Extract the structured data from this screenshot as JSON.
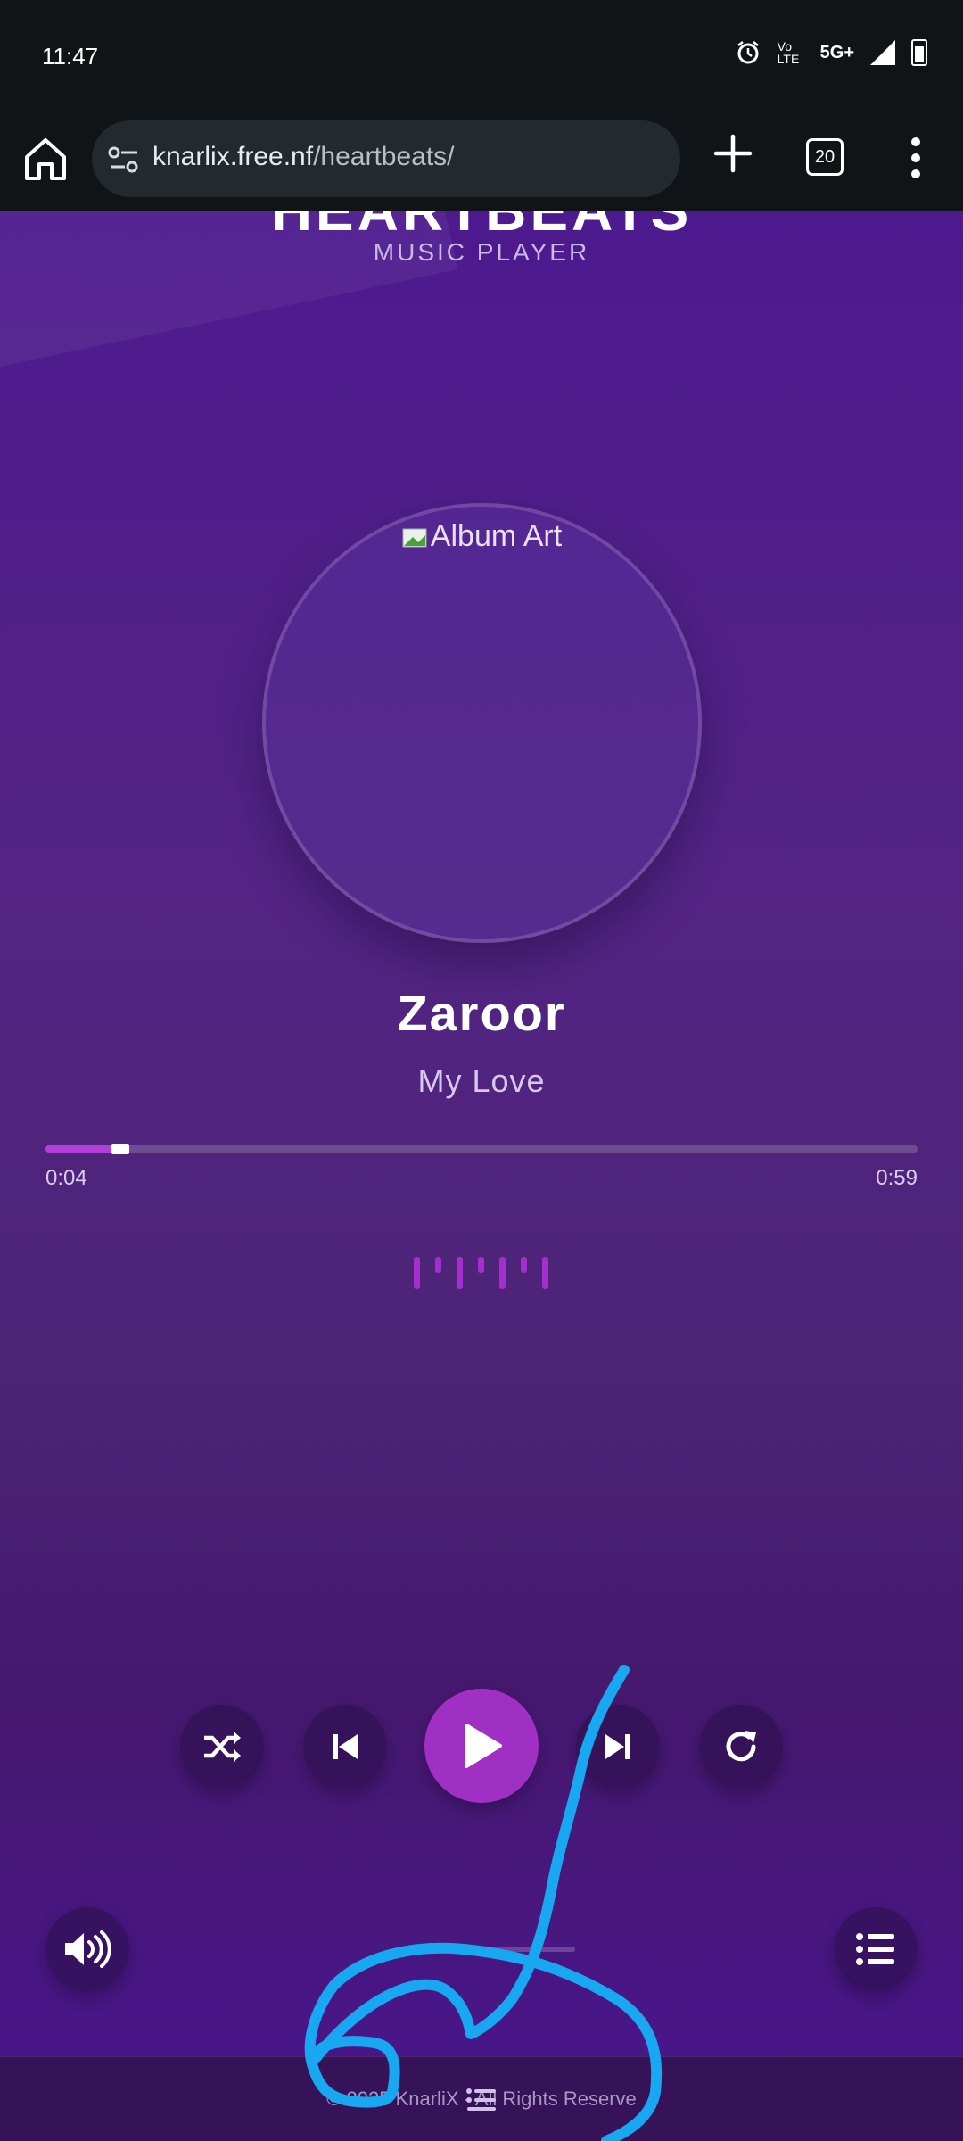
{
  "status_bar": {
    "time": "11:47",
    "icons": [
      "alarm-icon",
      "volte-icon",
      "5g-plus-icon",
      "signal-icon",
      "battery-icon"
    ],
    "volte_label": "Vo LTE",
    "network_label": "5G+"
  },
  "browser": {
    "url_host": "knarlix.free.nf",
    "url_path": "/heartbeats/",
    "tab_count": "20"
  },
  "header": {
    "title": "HEARTBEATS",
    "subtitle": "MUSIC PLAYER"
  },
  "player": {
    "album_art_alt": "Album Art",
    "song_title": "Zaroor",
    "artist": "My Love",
    "time_current": "0:04",
    "time_total": "0:59",
    "progress_fraction": 0.08
  },
  "controls": [
    "shuffle-icon",
    "previous-icon",
    "play-icon",
    "next-icon",
    "repeat-icon"
  ],
  "footer": {
    "text": "© 2025 KnarliX - All Rights Reserve"
  },
  "colors": {
    "accent": "#a030c4",
    "annotation": "#18a8f2",
    "background": "#4a1b86"
  }
}
